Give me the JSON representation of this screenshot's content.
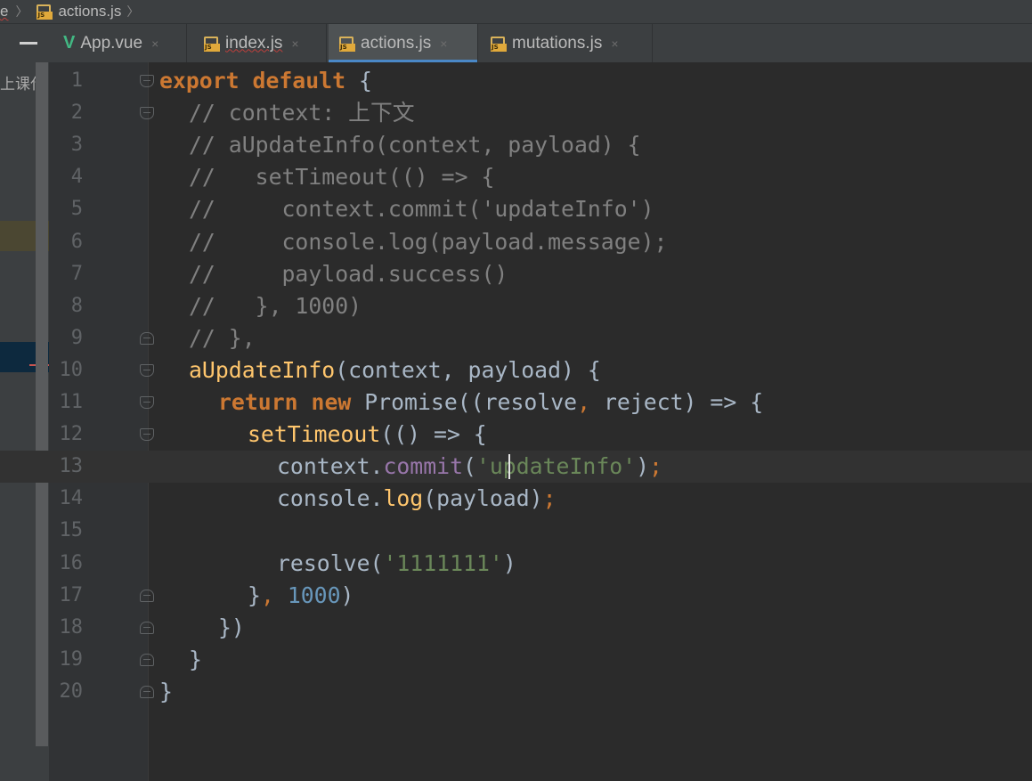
{
  "breadcrumb": {
    "parent": "e",
    "separator": "〉",
    "file": "actions.js"
  },
  "left_panel": {
    "label": "上课代"
  },
  "tabs": [
    {
      "label": "App.vue",
      "icon": "vue-icon",
      "active": false
    },
    {
      "label": "index.js",
      "icon": "js-file-icon",
      "active": false
    },
    {
      "label": "actions.js",
      "icon": "js-file-icon",
      "active": true
    },
    {
      "label": "mutations.js",
      "icon": "js-file-icon",
      "active": false
    }
  ],
  "tab_close_glyph": "×",
  "editor": {
    "current_line": 13,
    "lines": [
      {
        "num": "1",
        "fold": "down",
        "indent": 0,
        "tokens": [
          [
            "kwb",
            "export"
          ],
          [
            "t",
            " "
          ],
          [
            "kwb",
            "default"
          ],
          [
            "t",
            " {"
          ]
        ]
      },
      {
        "num": "2",
        "fold": "down",
        "indent": 1,
        "tokens": [
          [
            "cm",
            "// context: 上下文"
          ]
        ]
      },
      {
        "num": "3",
        "fold": "",
        "indent": 1,
        "tokens": [
          [
            "cm",
            "// aUpdateInfo(context, payload) {"
          ]
        ]
      },
      {
        "num": "4",
        "fold": "",
        "indent": 1,
        "tokens": [
          [
            "cm",
            "//   setTimeout(() => {"
          ]
        ]
      },
      {
        "num": "5",
        "fold": "",
        "indent": 1,
        "tokens": [
          [
            "cm",
            "//     context.commit('updateInfo')"
          ]
        ]
      },
      {
        "num": "6",
        "fold": "",
        "indent": 1,
        "tokens": [
          [
            "cm",
            "//     console.log(payload.message);"
          ]
        ]
      },
      {
        "num": "7",
        "fold": "",
        "indent": 1,
        "tokens": [
          [
            "cm",
            "//     payload.success()"
          ]
        ]
      },
      {
        "num": "8",
        "fold": "",
        "indent": 1,
        "tokens": [
          [
            "cm",
            "//   }, 1000)"
          ]
        ]
      },
      {
        "num": "9",
        "fold": "up",
        "indent": 1,
        "tokens": [
          [
            "cm",
            "// },"
          ]
        ]
      },
      {
        "num": "10",
        "fold": "down",
        "indent": 1,
        "tokens": [
          [
            "fn",
            "aUpdateInfo"
          ],
          [
            "t",
            "(context, payload) {"
          ]
        ]
      },
      {
        "num": "11",
        "fold": "down",
        "indent": 2,
        "tokens": [
          [
            "kwb",
            "return"
          ],
          [
            "t",
            " "
          ],
          [
            "kwb",
            "new"
          ],
          [
            "t",
            " Promise((resolve"
          ],
          [
            "kw",
            ","
          ],
          [
            "t",
            " reject) => {"
          ]
        ]
      },
      {
        "num": "12",
        "fold": "down",
        "indent": 3,
        "tokens": [
          [
            "fn",
            "setTimeout"
          ],
          [
            "t",
            "(() => {"
          ]
        ]
      },
      {
        "num": "13",
        "fold": "",
        "indent": 4,
        "tokens": [
          [
            "t",
            "context."
          ],
          [
            "fld",
            "commit"
          ],
          [
            "t",
            "("
          ],
          [
            "str",
            "'updateInfo'"
          ],
          [
            "t",
            ")"
          ],
          [
            "kw",
            ";"
          ]
        ]
      },
      {
        "num": "14",
        "fold": "",
        "indent": 4,
        "tokens": [
          [
            "t",
            "console."
          ],
          [
            "fn",
            "log"
          ],
          [
            "t",
            "(payload)"
          ],
          [
            "kw",
            ";"
          ]
        ]
      },
      {
        "num": "15",
        "fold": "",
        "indent": 4,
        "tokens": []
      },
      {
        "num": "16",
        "fold": "",
        "indent": 4,
        "tokens": [
          [
            "t",
            "resolve("
          ],
          [
            "str",
            "'1111111'"
          ],
          [
            "t",
            ")"
          ]
        ]
      },
      {
        "num": "17",
        "fold": "up",
        "indent": 3,
        "tokens": [
          [
            "t",
            "}"
          ],
          [
            "kw",
            ","
          ],
          [
            "t",
            " "
          ],
          [
            "num",
            "1000"
          ],
          [
            "t",
            ")"
          ]
        ]
      },
      {
        "num": "18",
        "fold": "up",
        "indent": 2,
        "tokens": [
          [
            "t",
            "})"
          ]
        ]
      },
      {
        "num": "19",
        "fold": "up",
        "indent": 1,
        "tokens": [
          [
            "t",
            "}"
          ]
        ]
      },
      {
        "num": "20",
        "fold": "up",
        "indent": 0,
        "tokens": [
          [
            "t",
            "}"
          ]
        ]
      }
    ]
  }
}
